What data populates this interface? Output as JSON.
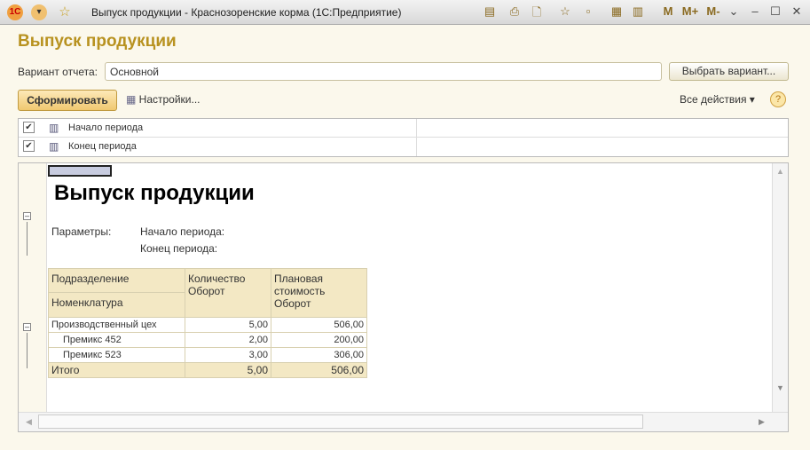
{
  "window": {
    "title": "Выпуск продукции - Краснозоренские корма  (1С:Предприятие)",
    "memory_buttons": [
      "M",
      "M+",
      "M-"
    ]
  },
  "page": {
    "title": "Выпуск продукции"
  },
  "variant": {
    "label": "Вариант отчета:",
    "value": "Основной",
    "choose_button": "Выбрать вариант..."
  },
  "toolbar": {
    "generate": "Сформировать",
    "settings": "Настройки...",
    "all_actions": "Все действия ▾",
    "help": "?"
  },
  "params": [
    {
      "label": "Начало периода",
      "checked": true
    },
    {
      "label": "Конец периода",
      "checked": true
    }
  ],
  "report": {
    "title": "Выпуск продукции",
    "params_label": "Параметры:",
    "param1": "Начало периода:",
    "param2": "Конец периода:",
    "headers": {
      "col1a": "Подразделение",
      "col1b": "Номенклатура",
      "col2": "Количество Оборот",
      "col3": "Плановая стоимость Оборот"
    },
    "rows": [
      {
        "name": "Производственный цех",
        "qty": "5,00",
        "cost": "506,00"
      },
      {
        "name": "Премикс 452",
        "qty": "2,00",
        "cost": "200,00"
      },
      {
        "name": "Премикс 523",
        "qty": "3,00",
        "cost": "306,00"
      }
    ],
    "total": {
      "name": "Итого",
      "qty": "5,00",
      "cost": "506,00"
    }
  }
}
